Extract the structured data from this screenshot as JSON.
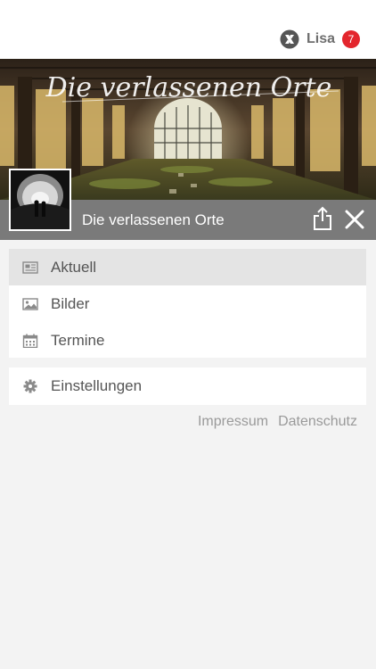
{
  "header": {
    "user_name": "Lisa",
    "notification_count": "7",
    "logo_icon": "app-logo-icon"
  },
  "group": {
    "banner_title": "Die verlassenen Orte",
    "title": "Die verlassenen Orte",
    "share_icon": "share-icon",
    "close_icon": "close-icon"
  },
  "menu": {
    "items": [
      {
        "label": "Aktuell",
        "icon": "newspaper-icon",
        "active": true
      },
      {
        "label": "Bilder",
        "icon": "image-icon",
        "active": false
      },
      {
        "label": "Termine",
        "icon": "calendar-icon",
        "active": false
      }
    ],
    "settings": {
      "label": "Einstellungen",
      "icon": "gear-icon"
    }
  },
  "footer_links": {
    "impressum": "Impressum",
    "datenschutz": "Datenschutz"
  },
  "colors": {
    "badge": "#e3262d",
    "group_bar": "#7a7a7a",
    "active_item": "#e4e4e4",
    "background": "#f3f3f3"
  }
}
